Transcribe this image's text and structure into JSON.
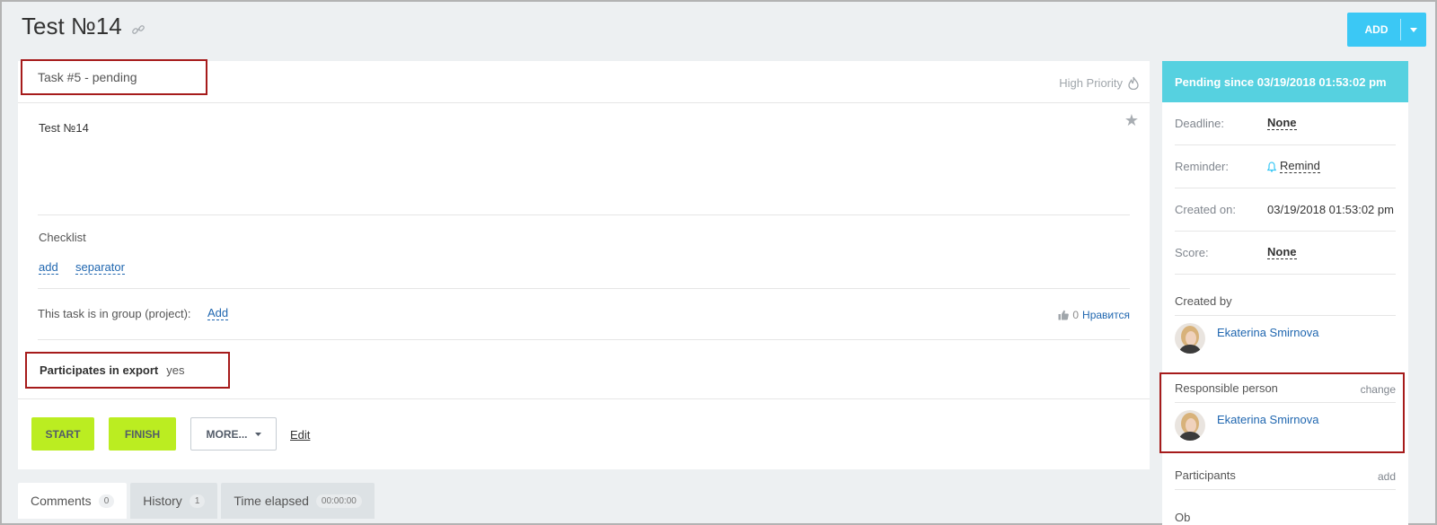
{
  "header": {
    "title": "Test №14",
    "add_label": "ADD"
  },
  "task": {
    "status": "Task #5 - pending",
    "priority": "High Priority",
    "description": "Test №14",
    "checklist_title": "Checklist",
    "checklist_add": "add",
    "checklist_separator": "separator",
    "group_text": "This task is in group (project):",
    "group_add": "Add",
    "likes_count": "0",
    "likes_label": "Нравится",
    "export_label": "Participates in export",
    "export_value": "yes"
  },
  "actions": {
    "start": "START",
    "finish": "FINISH",
    "more": "MORE...",
    "edit": "Edit"
  },
  "tabs": [
    {
      "label": "Comments",
      "badge": "0"
    },
    {
      "label": "History",
      "badge": "1"
    },
    {
      "label": "Time elapsed",
      "badge": "00:00:00"
    }
  ],
  "sidebar": {
    "status_header": "Pending since 03/19/2018 01:53:02 pm",
    "deadline_label": "Deadline:",
    "deadline_value": "None",
    "reminder_label": "Reminder:",
    "reminder_value": "Remind",
    "created_on_label": "Created on:",
    "created_on_value": "03/19/2018 01:53:02 pm",
    "score_label": "Score:",
    "score_value": "None",
    "created_by_label": "Created by",
    "created_by_name": "Ekaterina Smirnova",
    "responsible_label": "Responsible person",
    "responsible_change": "change",
    "responsible_name": "Ekaterina Smirnova",
    "participants_label": "Participants",
    "participants_add": "add",
    "observers_partial": "Ob"
  },
  "colors": {
    "accent_blue": "#3bc8f5",
    "status_cyan": "#56d1e0",
    "button_green": "#bbed21",
    "highlight_red": "#a61b1b",
    "link_blue": "#2067b0"
  }
}
